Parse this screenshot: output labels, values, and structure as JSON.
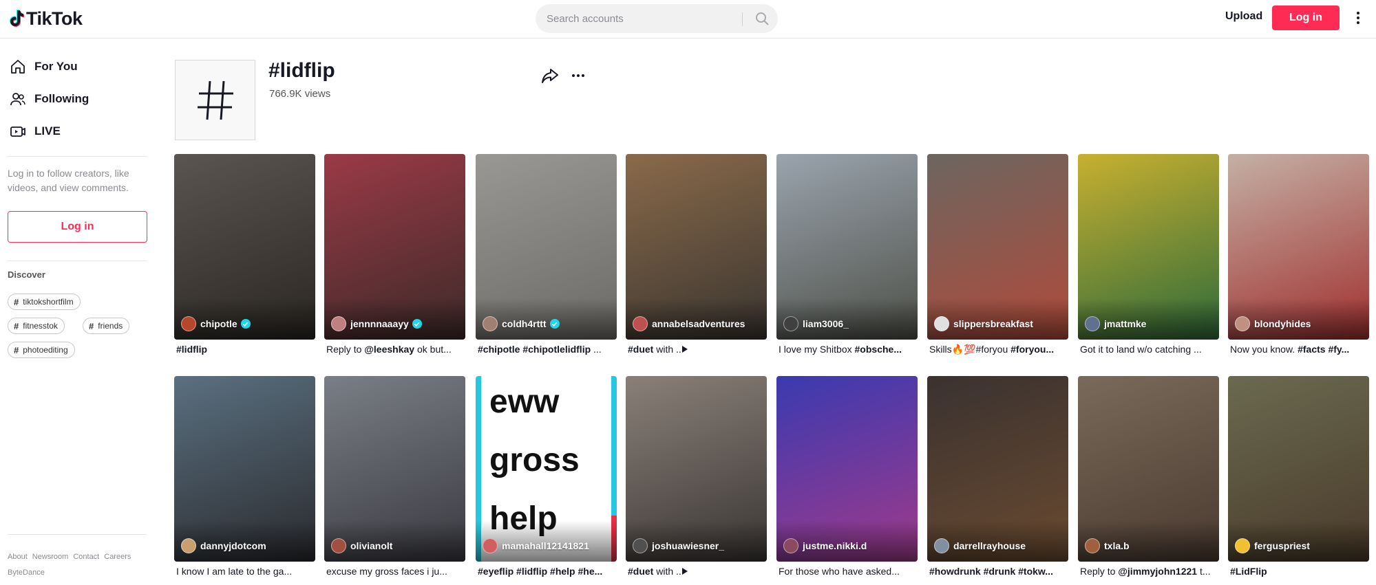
{
  "header": {
    "logo_text": "TikTok",
    "search_placeholder": "Search accounts",
    "upload_label": "Upload",
    "login_label": "Log in"
  },
  "sidebar": {
    "nav": [
      {
        "label": "For You",
        "icon": "home-icon"
      },
      {
        "label": "Following",
        "icon": "users-icon"
      },
      {
        "label": "LIVE",
        "icon": "live-icon"
      }
    ],
    "login_hint": "Log in to follow creators, like videos, and view comments.",
    "login_label": "Log in",
    "discover_title": "Discover",
    "discover_tags": [
      "tiktokshortfilm",
      "fitnesstok",
      "friends",
      "photoediting"
    ],
    "footer_links": [
      "About",
      "Newsroom",
      "Contact",
      "Careers"
    ],
    "footer_company": "ByteDance"
  },
  "hashtag": {
    "title": "#lidflip",
    "views": "766.9K views"
  },
  "videos": [
    {
      "author": "chipotle",
      "verified": true,
      "caption": "#lidflip",
      "colors": [
        "#5a5550",
        "#2a2622"
      ],
      "avatar": "#b7472a"
    },
    {
      "author": "jennnnaaayy",
      "verified": true,
      "caption": "Reply to @leeshkay ok but...",
      "colors": [
        "#9b3a47",
        "#3c2a28"
      ],
      "avatar": "#c08080"
    },
    {
      "author": "coldh4rttt",
      "verified": true,
      "caption": "#chipotle #chipotlelidflip ...",
      "colors": [
        "#9a9894",
        "#6c6a66"
      ],
      "avatar": "#a08070"
    },
    {
      "author": "annabelsadventures",
      "verified": false,
      "caption": "#duet with ...",
      "colors": [
        "#8a6a4a",
        "#3a3530"
      ],
      "avatar": "#c05050"
    },
    {
      "author": "liam3006_",
      "verified": false,
      "caption": "I love my Shitbox #obsche...",
      "colors": [
        "#9aa4ae",
        "#4e5048"
      ],
      "avatar": "#404040"
    },
    {
      "author": "slippersbreakfast",
      "verified": false,
      "caption": "Skills🔥💯#foryou #foryou...",
      "colors": [
        "#6c6660",
        "#b04a3a"
      ],
      "avatar": "#e0e0e0"
    },
    {
      "author": "jmattmke",
      "verified": false,
      "caption": "Got it to land w/o catching ...",
      "colors": [
        "#c8b030",
        "#2e6a3a"
      ],
      "avatar": "#607090"
    },
    {
      "author": "blondyhides",
      "verified": false,
      "caption": "Now you know. #facts #fy...",
      "colors": [
        "#c4b0a4",
        "#a03030"
      ],
      "avatar": "#c09080"
    },
    {
      "author": "dannyjdotcom",
      "verified": false,
      "caption": "I know I am late to the ga...",
      "colors": [
        "#5a7080",
        "#2a2a2e"
      ],
      "avatar": "#c8a070"
    },
    {
      "author": "olivianolt",
      "verified": false,
      "caption": "excuse my gross faces i ju...",
      "colors": [
        "#7a7e86",
        "#3a3a40"
      ],
      "avatar": "#a05040"
    },
    {
      "author": "mamahall12141821",
      "verified": false,
      "caption": "#eyeflip #lidflip #help #he...",
      "colors": [
        "#ffffff",
        "#ffffff"
      ],
      "avatar": "#d06060",
      "words": [
        "eww",
        "gross",
        "help"
      ]
    },
    {
      "author": "joshuawiesner_",
      "verified": false,
      "caption": "#duet with ...",
      "colors": [
        "#8a8078",
        "#3a3634"
      ],
      "avatar": "#505050"
    },
    {
      "author": "justme.nikki.d",
      "verified": false,
      "caption": "For those who have asked...",
      "colors": [
        "#3a3ab0",
        "#a03a8a"
      ],
      "avatar": "#8a4a60"
    },
    {
      "author": "darrellrayhouse",
      "verified": false,
      "caption": "#howdrunk #drunk #tokw...",
      "colors": [
        "#3a3230",
        "#6a4a30"
      ],
      "avatar": "#8090a0"
    },
    {
      "author": "txla.b",
      "verified": false,
      "caption": "Reply to @jimmyjohn1221 t...",
      "colors": [
        "#7a6a5a",
        "#4a3a30"
      ],
      "avatar": "#a06040"
    },
    {
      "author": "ferguspriest",
      "verified": false,
      "caption": "#LidFlip",
      "colors": [
        "#6a6a50",
        "#4a3a2a"
      ],
      "avatar": "#f0c030"
    }
  ]
}
